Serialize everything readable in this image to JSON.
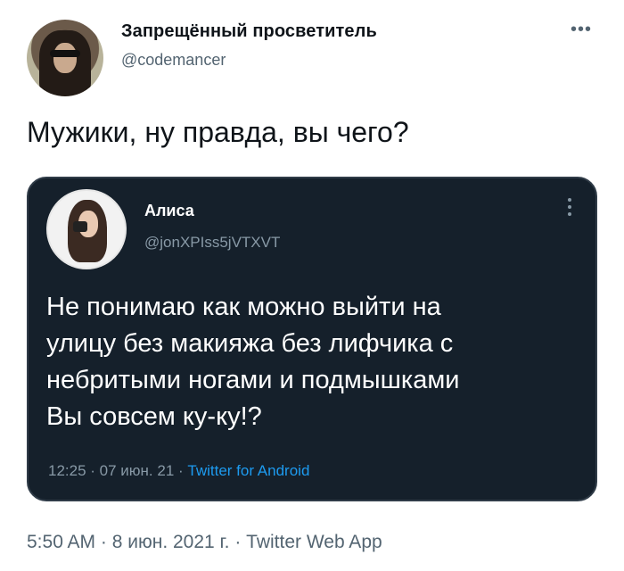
{
  "tweet": {
    "author_name": "Запрещённый просветитель",
    "author_handle": "@codemancer",
    "text": "Мужики, ну правда, вы чего?",
    "more_icon": "more-horizontal-icon",
    "footer": {
      "time": "5:50 AM",
      "sep1": " · ",
      "date": "8 июн. 2021 г.",
      "sep2": " · ",
      "source": "Twitter Web App"
    }
  },
  "quoted": {
    "author_name": "Алиса",
    "author_handle": "@jonXPIss5jVTXVT",
    "more_icon": "more-vertical-icon",
    "lines": [
      "Не понимаю как можно выйти на",
      "улицу без макияжа без лифчика с",
      "небритыми ногами и подмышками",
      "Вы совсем ку-ку!?"
    ],
    "meta": {
      "time": "12:25",
      "sep1": " · ",
      "date": "07 июн. 21",
      "sep2": " · ",
      "source": "Twitter for Android"
    }
  },
  "colors": {
    "quote_background": "#15202b",
    "link_blue": "#1d9bf0",
    "secondary_text": "#536471"
  }
}
